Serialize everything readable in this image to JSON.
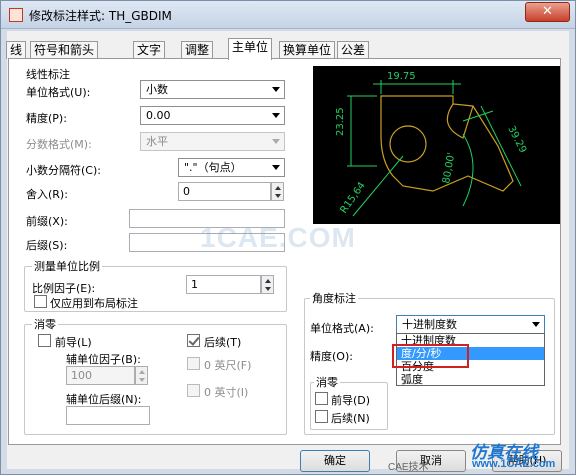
{
  "window": {
    "title": "修改标注样式: TH_GBDIM",
    "close_glyph": "✕"
  },
  "tabs": [
    {
      "label": "线",
      "active": false
    },
    {
      "label": "符号和箭头",
      "active": false
    },
    {
      "label": "文字",
      "active": false
    },
    {
      "label": "调整",
      "active": false
    },
    {
      "label": "主单位",
      "active": true
    },
    {
      "label": "换算单位",
      "active": false
    },
    {
      "label": "公差",
      "active": false
    }
  ],
  "linear": {
    "group_label": "线性标注",
    "unit_format_label": "单位格式(U):",
    "unit_format_value": "小数",
    "precision_label": "精度(P):",
    "precision_value": "0.00",
    "fraction_label": "分数格式(M):",
    "fraction_value": "水平",
    "decimal_sep_label": "小数分隔符(C):",
    "decimal_sep_value": "\".\"（句点）",
    "round_label": "舍入(R):",
    "round_value": "0",
    "prefix_label": "前缀(X):",
    "prefix_value": "",
    "suffix_label": "后缀(S):",
    "suffix_value": ""
  },
  "scale": {
    "group_label": "测量单位比例",
    "factor_label": "比例因子(E):",
    "factor_value": "1",
    "layout_only_label": "仅应用到布局标注"
  },
  "zero_linear": {
    "group_label": "消零",
    "leading_label": "前导(L)",
    "leading_checked": false,
    "sub_factor_label": "辅单位因子(B):",
    "sub_factor_value": "100",
    "sub_suffix_label": "辅单位后缀(N):",
    "sub_suffix_value": "",
    "trailing_label": "后续(T)",
    "trailing_checked": true,
    "feet_label": "0 英尺(F)",
    "inch_label": "0 英寸(I)"
  },
  "preview": {
    "dim_top": "19.75",
    "dim_left": "23.25",
    "dim_right": "39.29",
    "dim_angle": "80,00'",
    "dim_radius": "R15,64",
    "line_color": "#c8a020",
    "text_color": "#22d060",
    "bg_color": "#000000"
  },
  "angular": {
    "group_label": "角度标注",
    "unit_format_label": "单位格式(A):",
    "unit_format_value": "十进制度数",
    "options": [
      "十进制度数",
      "度/分/秒",
      "百分度",
      "弧度"
    ],
    "selected_option_index": 1,
    "precision_label": "精度(O):",
    "zero_group_label": "消零",
    "leading_label": "前导(D)",
    "trailing_label": "后续(N)"
  },
  "buttons": {
    "ok": "确定",
    "cancel": "取消",
    "help": "帮助(H)"
  },
  "watermark": {
    "center": "1CAE.COM",
    "bottom_right_cn": "仿真在线",
    "bottom_right_url": "www.1CAE.com",
    "wechat_label": "CAE技术"
  }
}
